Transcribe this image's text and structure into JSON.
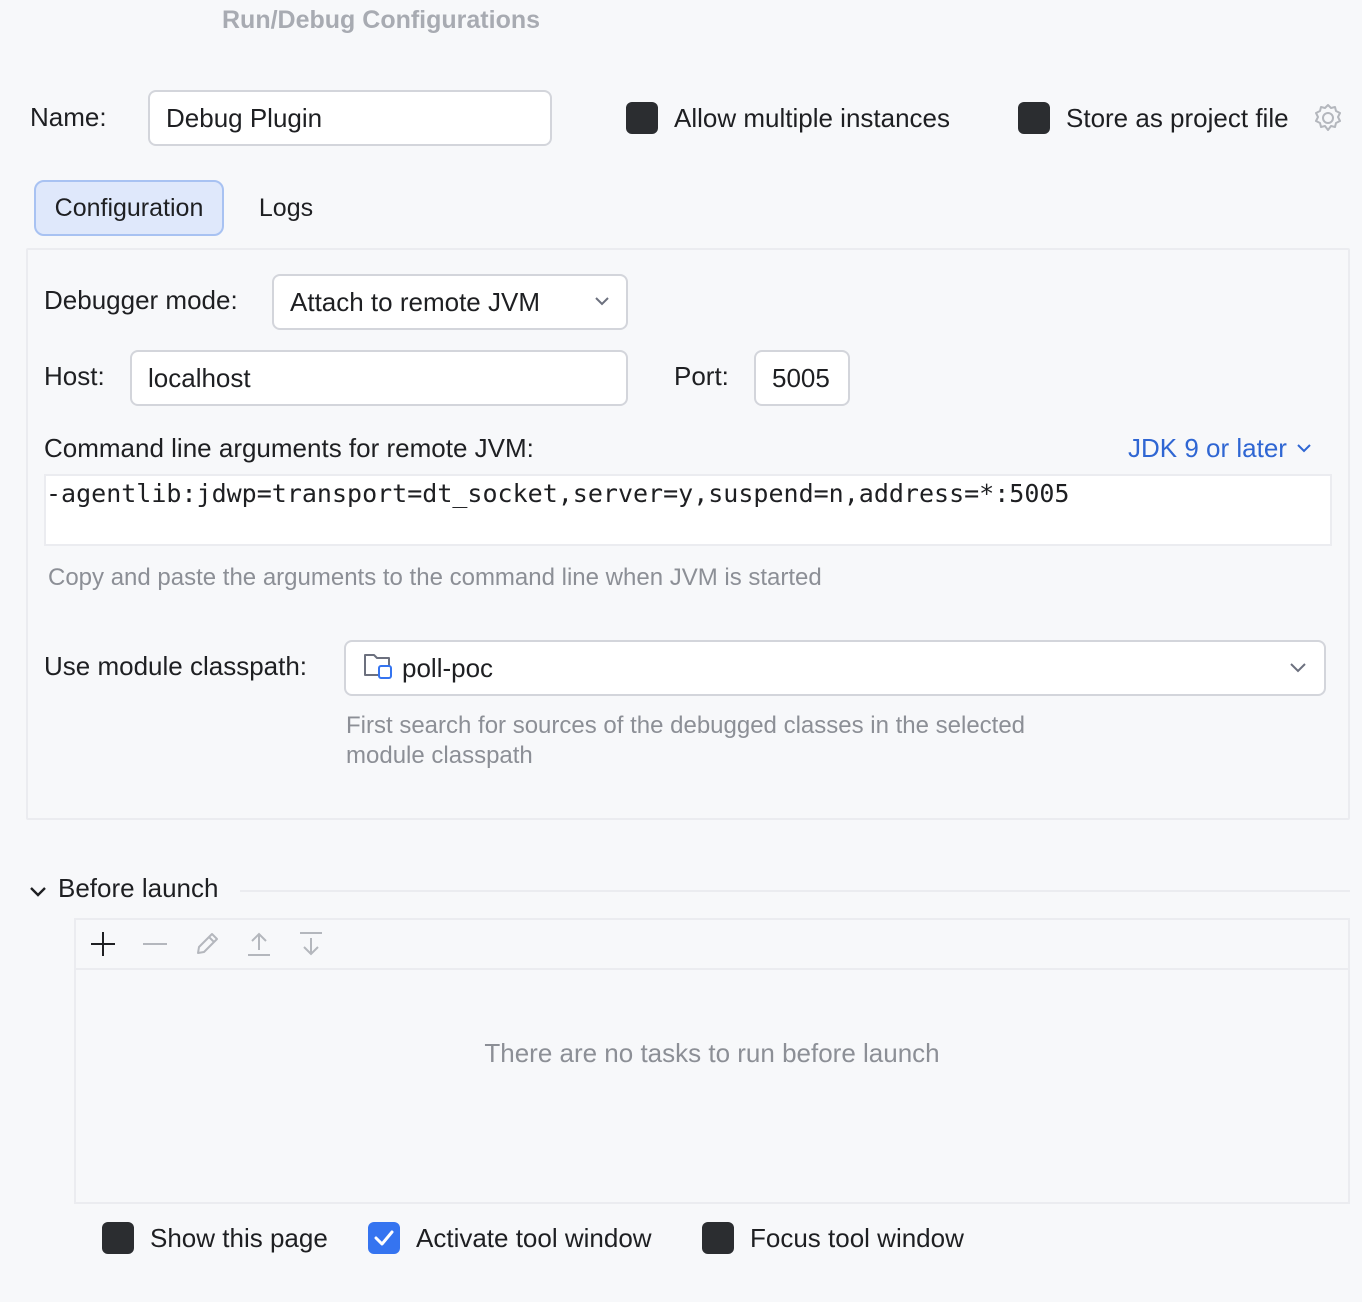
{
  "window": {
    "title": "Run/Debug Configurations"
  },
  "header": {
    "name_label": "Name:",
    "name_value": "Debug Plugin",
    "allow_multiple_label": "Allow multiple instances",
    "allow_multiple_checked": false,
    "store_project_label": "Store as project file",
    "store_project_checked": false
  },
  "tabs": [
    {
      "label": "Configuration",
      "active": true
    },
    {
      "label": "Logs",
      "active": false
    }
  ],
  "configuration": {
    "debugger_mode_label": "Debugger mode:",
    "debugger_mode_value": "Attach to remote JVM",
    "host_label": "Host:",
    "host_value": "localhost",
    "port_label": "Port:",
    "port_value": "5005",
    "cmd_args_label": "Command line arguments for remote JVM:",
    "jdk_link": "JDK 9 or later",
    "cmd_args_value": "-agentlib:jdwp=transport=dt_socket,server=y,suspend=n,address=*:5005",
    "cmd_args_hint": "Copy and paste the arguments to the command line when JVM is started",
    "module_label": "Use module classpath:",
    "module_value": "poll-poc",
    "module_hint_line1": "First search for sources of the debugged classes in the selected",
    "module_hint_line2": "module classpath"
  },
  "before_launch": {
    "title": "Before launch",
    "empty_text": "There are no tasks to run before launch",
    "toolbar_icons": [
      "add-icon",
      "remove-icon",
      "edit-icon",
      "move-up-icon",
      "move-down-icon"
    ]
  },
  "footer": {
    "show_page_label": "Show this page",
    "show_page_checked": false,
    "activate_tool_label": "Activate tool window",
    "activate_tool_checked": true,
    "focus_tool_label": "Focus tool window",
    "focus_tool_checked": false
  },
  "colors": {
    "accent": "#3574f0",
    "link": "#2f66d3",
    "checkbox_unchecked": "#2b2d30",
    "hint": "#8c8f96"
  }
}
